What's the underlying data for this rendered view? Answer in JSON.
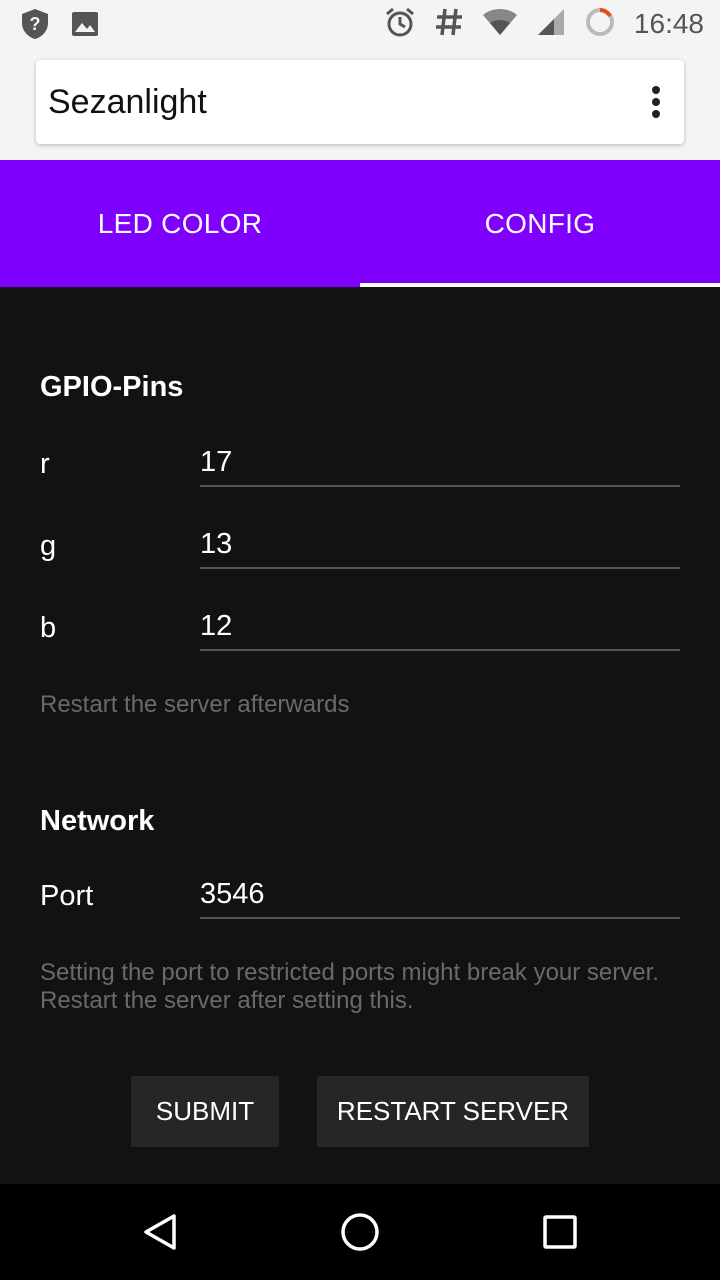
{
  "status_bar": {
    "time": "16:48",
    "icons_left": [
      "shield-question-icon",
      "image-icon"
    ],
    "icons_right": [
      "alarm-icon",
      "hash-icon",
      "wifi-icon",
      "cell-signal-icon",
      "battery-icon"
    ]
  },
  "app_bar": {
    "title": "Sezanlight",
    "overflow_icon": "more-vert-icon"
  },
  "tabs": [
    {
      "label": "LED COLOR",
      "active": false
    },
    {
      "label": "CONFIG",
      "active": true
    }
  ],
  "config": {
    "gpio_section_title": "GPIO-Pins",
    "gpio_fields": [
      {
        "label": "r",
        "value": "17"
      },
      {
        "label": "g",
        "value": "13"
      },
      {
        "label": "b",
        "value": "12"
      }
    ],
    "gpio_hint": "Restart the server afterwards",
    "network_section_title": "Network",
    "port_label": "Port",
    "port_value": "3546",
    "network_hint": "Setting the port to restricted ports might break your server. Restart the server after setting this.",
    "submit_label": "SUBMIT",
    "restart_label": "RESTART SERVER"
  },
  "colors": {
    "accent": "#8000ff",
    "background": "#121212",
    "button": "#262626"
  },
  "nav_bar": {
    "icons": [
      "back-icon",
      "home-icon",
      "recents-icon"
    ]
  }
}
